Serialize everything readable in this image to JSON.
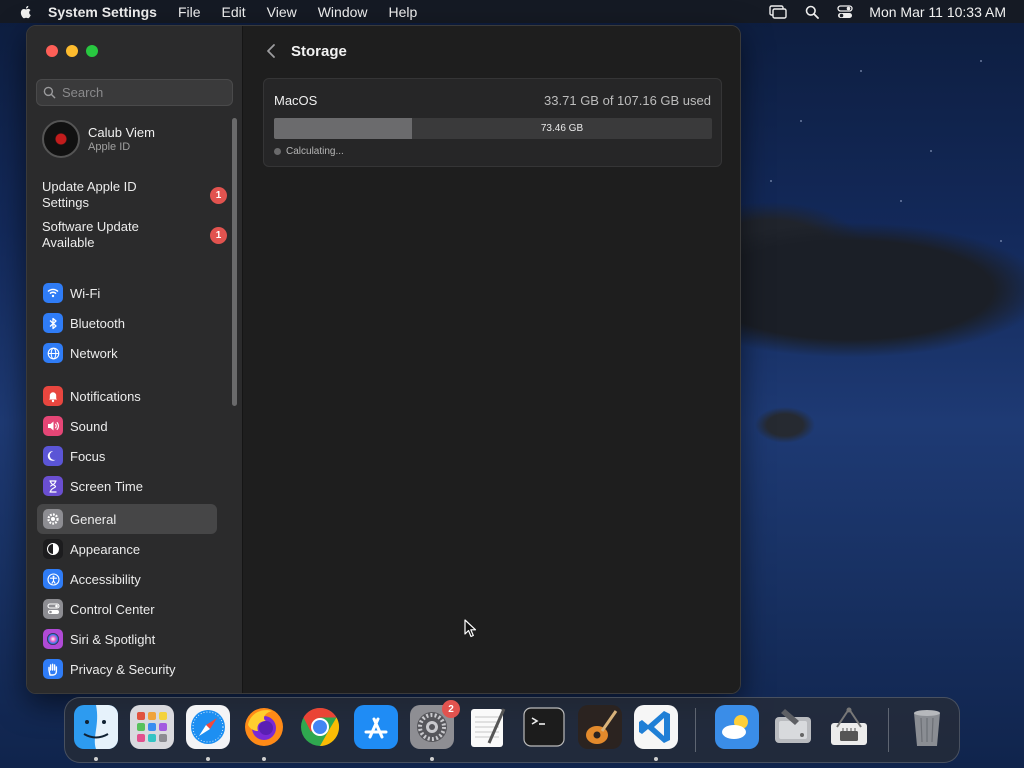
{
  "menubar": {
    "app_name": "System Settings",
    "menus": [
      "File",
      "Edit",
      "View",
      "Window",
      "Help"
    ],
    "clock": "Mon Mar 11  10:33 AM",
    "status_icons": [
      "screen-mirroring-icon",
      "spotlight-search-icon",
      "control-center-icon"
    ]
  },
  "sidebar": {
    "search_placeholder": "Search",
    "profile": {
      "name": "Calub Viem",
      "subtitle": "Apple ID"
    },
    "notices": [
      {
        "label": "Update Apple ID Settings",
        "badge": "1"
      },
      {
        "label": "Software Update Available",
        "badge": "1"
      }
    ],
    "items": [
      {
        "label": "Wi-Fi",
        "icon": "wifi-icon",
        "color": "#2f7cf6"
      },
      {
        "label": "Bluetooth",
        "icon": "bluetooth-icon",
        "color": "#2f7cf6"
      },
      {
        "label": "Network",
        "icon": "globe-icon",
        "color": "#2f7cf6"
      },
      {
        "label": "Notifications",
        "icon": "bell-icon",
        "color": "#e8463f"
      },
      {
        "label": "Sound",
        "icon": "speaker-icon",
        "color": "#e54676"
      },
      {
        "label": "Focus",
        "icon": "moon-icon",
        "color": "#5b55d6"
      },
      {
        "label": "Screen Time",
        "icon": "hourglass-icon",
        "color": "#6a4fd1"
      },
      {
        "label": "General",
        "icon": "gear-icon",
        "color": "#8d8d92",
        "selected": true
      },
      {
        "label": "Appearance",
        "icon": "appearance-icon",
        "color": "#1c1c1e"
      },
      {
        "label": "Accessibility",
        "icon": "accessibility-icon",
        "color": "#2f7cf6"
      },
      {
        "label": "Control Center",
        "icon": "toggles-icon",
        "color": "#8d8d92"
      },
      {
        "label": "Siri & Spotlight",
        "icon": "siri-icon",
        "color": "#b04ad6"
      },
      {
        "label": "Privacy & Security",
        "icon": "hand-icon",
        "color": "#2f7cf6"
      }
    ]
  },
  "content": {
    "title": "Storage",
    "storage": {
      "disk_name": "MacOS",
      "used_text": "33.71 GB of 107.16 GB used",
      "used_fraction": 0.3146,
      "free_label": "73.46 GB",
      "status": "Calculating..."
    }
  },
  "dock": {
    "apps": [
      {
        "name": "finder-icon",
        "running": true
      },
      {
        "name": "launchpad-icon",
        "running": false
      },
      {
        "name": "safari-icon",
        "running": true
      },
      {
        "name": "firefox-icon",
        "running": true
      },
      {
        "name": "chrome-icon",
        "running": false
      },
      {
        "name": "app-store-icon",
        "running": false
      },
      {
        "name": "system-settings-icon",
        "running": true,
        "badge": "2"
      },
      {
        "name": "textedit-icon",
        "running": false
      },
      {
        "name": "terminal-icon",
        "running": false
      },
      {
        "name": "garageband-icon",
        "running": false
      },
      {
        "name": "vscode-icon",
        "running": true
      },
      {
        "name": "weather-icon",
        "running": false
      },
      {
        "name": "disk-utility-icon",
        "running": false
      },
      {
        "name": "system-information-icon",
        "running": false
      },
      {
        "name": "trash-icon",
        "running": false
      }
    ]
  }
}
